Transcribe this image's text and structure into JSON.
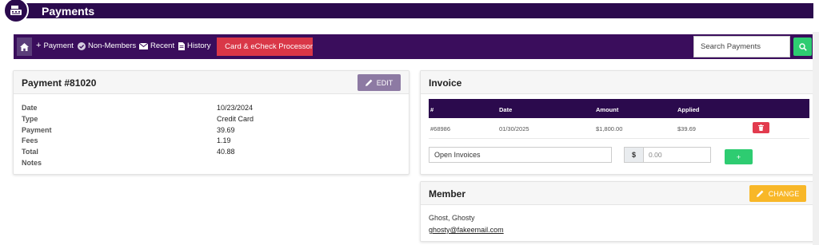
{
  "header": {
    "title": "Payments",
    "logo_icon": "cash-register-icon"
  },
  "toolbar": {
    "home_icon": "home-icon",
    "payment_label": "Payment",
    "non_members_label": "Non-Members",
    "recent_label": "Recent",
    "history_label": "History",
    "processor_label": "Card & eCheck Processor",
    "search_placeholder": "Search Payments",
    "colors": {
      "bar": "#3a0d5c",
      "processor": "#d93747",
      "search_button": "#2ecc71"
    }
  },
  "payment": {
    "title": "Payment #81020",
    "edit_label": "EDIT",
    "fields": [
      {
        "label": "Date",
        "value": "10/23/2024"
      },
      {
        "label": "Type",
        "value": "Credit Card"
      },
      {
        "label": "Payment",
        "value": "39.69"
      },
      {
        "label": "Fees",
        "value": "1.19"
      },
      {
        "label": "Total",
        "value": "40.88"
      },
      {
        "label": "Notes",
        "value": ""
      }
    ]
  },
  "invoice": {
    "title": "Invoice",
    "columns": [
      "#",
      "Date",
      "Amount",
      "Applied"
    ],
    "rows": [
      {
        "number": "#68986",
        "date": "01/30/2025",
        "amount": "$1,800.00",
        "applied": "$39.69"
      }
    ],
    "open_invoices_label": "Open Invoices",
    "currency_symbol": "$",
    "amount_placeholder": "0.00",
    "add_label": "+"
  },
  "member": {
    "title": "Member",
    "change_label": "CHANGE",
    "name": "Ghost, Ghosty",
    "email": "ghosty@fakeemail.com"
  }
}
